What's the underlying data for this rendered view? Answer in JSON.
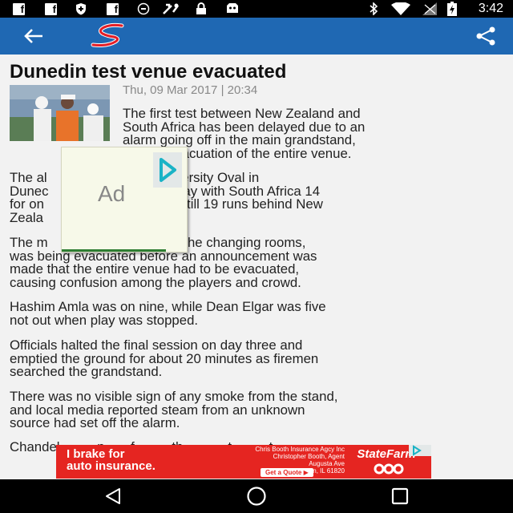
{
  "status_bar": {
    "time": "3:42",
    "notifications": [
      "facebook-icon",
      "facebook-icon",
      "shield-icon",
      "facebook-icon",
      "data-saver-icon",
      "tools-icon",
      "lock-icon",
      "game-icon"
    ],
    "system": [
      "bluetooth-icon",
      "wifi-icon",
      "signal-icon",
      "battery-icon"
    ]
  },
  "app_bar": {
    "background": "#1f68b3",
    "logo": "supersport-logo"
  },
  "article": {
    "title": "Dunedin test venue evacuated",
    "date": "Thu, 09 Mar 2017 | 20:34",
    "paragraphs": [
      [
        "The first test between New Zealand and",
        "South Africa has been delayed due to an",
        "alarm going off in the main grandstand,",
        "       an evacuation of the entire venue."
      ],
      [
        "The al          going off at University Oval in",
        "Dunec                    the third day with South Africa 14",
        "for on                  nd innings, still 19 runs behind New",
        "Zeala"
      ],
      [
        "The m                   ch houses the changing rooms,",
        "was being evacuated before an announcement was",
        "made that the entire venue had to be evacuated,",
        "causing confusion among the players and crowd."
      ],
      [
        "Hashim Amla was on nine, while Dean Elgar was five",
        "not out when play was stopped."
      ],
      [
        "Officials halted the final session on day three and",
        "emptied the ground for about 20 minutes as firemen",
        "searched the grandstand."
      ],
      [
        "There was no visible sign of any smoke from the stand,",
        "and local media reported steam from an unknown",
        "source had set off the alarm."
      ],
      [
        "Chandel          n       f          th            t          t"
      ]
    ]
  },
  "floating_ad": {
    "label": "Ad"
  },
  "banner_ad": {
    "headline": [
      "I brake for",
      "auto insurance."
    ],
    "agent_lines": [
      "Chris Booth Insurance Agcy Inc",
      "Christopher Booth, Agent",
      "Augusta Ave",
      "Champaign, IL 61820"
    ],
    "cta": "Get a Quote ▶",
    "brand": "StateFarm",
    "color": "#e52521"
  },
  "nav_bar": {
    "buttons": [
      "back-triangle-icon",
      "home-circle-icon",
      "recents-square-icon"
    ]
  }
}
